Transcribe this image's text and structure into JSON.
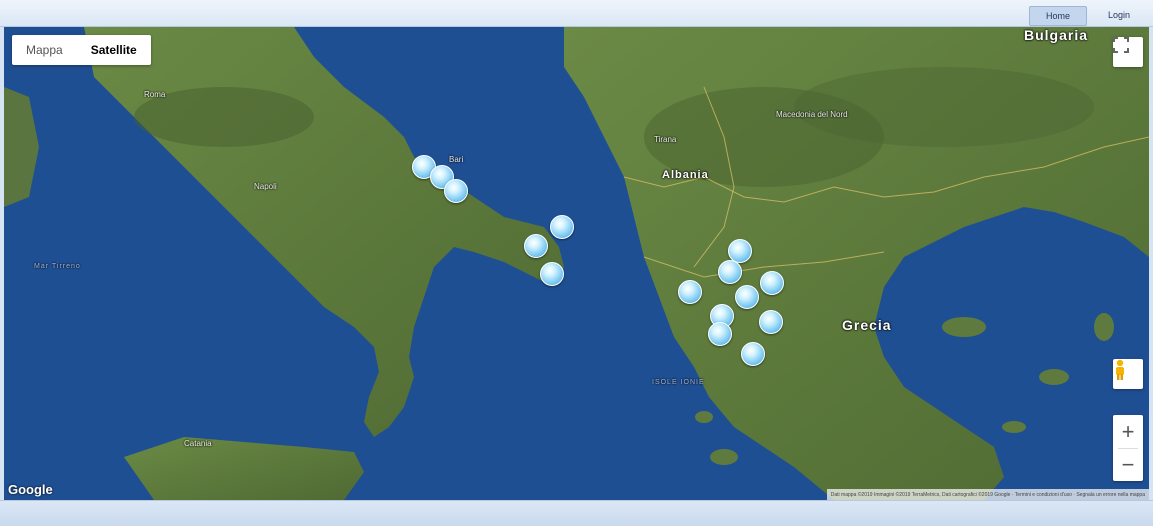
{
  "nav": {
    "home": "Home",
    "login": "Login"
  },
  "map_type": {
    "map": "Mappa",
    "satellite": "Satellite",
    "selected": "Satellite"
  },
  "labels": {
    "bulgaria": "Bulgaria",
    "albania": "Albania",
    "grecia": "Grecia",
    "macedonia": "Macedonia del Nord",
    "roma": "Roma",
    "napoli": "Napoli",
    "bari": "Bari",
    "tirana": "Tirana",
    "mar_tirreno": "Mar Tirreno",
    "isole_ionie": "ISOLE IONIE",
    "catania": "Catania"
  },
  "controls": {
    "fullscreen_icon": "fullscreen-icon",
    "pegman_icon": "pegman-icon",
    "zoom_in": "+",
    "zoom_out": "−"
  },
  "google_logo": "Google",
  "attribution": "Dati mappa ©2019 Immagini ©2019 TerraMetrics, Dati cartografici ©2019 Google · Termini e condizioni d'uso · Segnala un errore nella mappa",
  "markers": {
    "count": 16,
    "color": "#6fc3ef"
  },
  "colors": {
    "sea": "#1f4f93",
    "land": "#5f7a3e",
    "bar": "#d6e3f3"
  }
}
